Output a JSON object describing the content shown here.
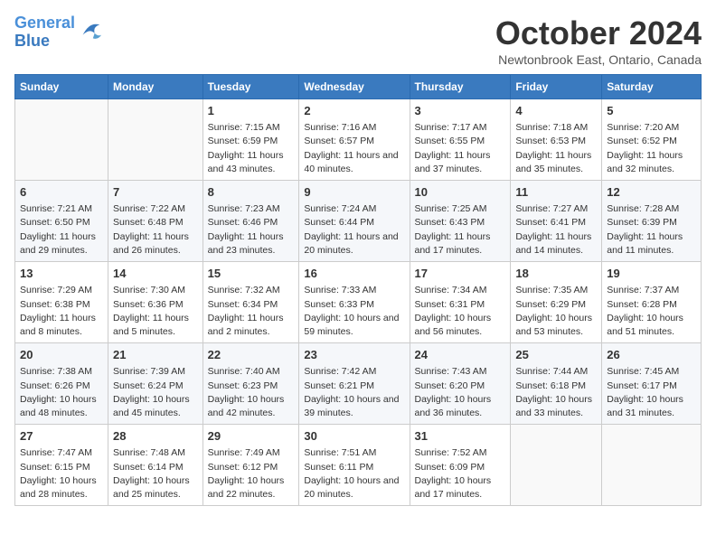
{
  "header": {
    "logo_line1": "General",
    "logo_line2": "Blue",
    "month_title": "October 2024",
    "location": "Newtonbrook East, Ontario, Canada"
  },
  "weekdays": [
    "Sunday",
    "Monday",
    "Tuesday",
    "Wednesday",
    "Thursday",
    "Friday",
    "Saturday"
  ],
  "weeks": [
    [
      {
        "num": "",
        "info": ""
      },
      {
        "num": "",
        "info": ""
      },
      {
        "num": "1",
        "info": "Sunrise: 7:15 AM\nSunset: 6:59 PM\nDaylight: 11 hours and 43 minutes."
      },
      {
        "num": "2",
        "info": "Sunrise: 7:16 AM\nSunset: 6:57 PM\nDaylight: 11 hours and 40 minutes."
      },
      {
        "num": "3",
        "info": "Sunrise: 7:17 AM\nSunset: 6:55 PM\nDaylight: 11 hours and 37 minutes."
      },
      {
        "num": "4",
        "info": "Sunrise: 7:18 AM\nSunset: 6:53 PM\nDaylight: 11 hours and 35 minutes."
      },
      {
        "num": "5",
        "info": "Sunrise: 7:20 AM\nSunset: 6:52 PM\nDaylight: 11 hours and 32 minutes."
      }
    ],
    [
      {
        "num": "6",
        "info": "Sunrise: 7:21 AM\nSunset: 6:50 PM\nDaylight: 11 hours and 29 minutes."
      },
      {
        "num": "7",
        "info": "Sunrise: 7:22 AM\nSunset: 6:48 PM\nDaylight: 11 hours and 26 minutes."
      },
      {
        "num": "8",
        "info": "Sunrise: 7:23 AM\nSunset: 6:46 PM\nDaylight: 11 hours and 23 minutes."
      },
      {
        "num": "9",
        "info": "Sunrise: 7:24 AM\nSunset: 6:44 PM\nDaylight: 11 hours and 20 minutes."
      },
      {
        "num": "10",
        "info": "Sunrise: 7:25 AM\nSunset: 6:43 PM\nDaylight: 11 hours and 17 minutes."
      },
      {
        "num": "11",
        "info": "Sunrise: 7:27 AM\nSunset: 6:41 PM\nDaylight: 11 hours and 14 minutes."
      },
      {
        "num": "12",
        "info": "Sunrise: 7:28 AM\nSunset: 6:39 PM\nDaylight: 11 hours and 11 minutes."
      }
    ],
    [
      {
        "num": "13",
        "info": "Sunrise: 7:29 AM\nSunset: 6:38 PM\nDaylight: 11 hours and 8 minutes."
      },
      {
        "num": "14",
        "info": "Sunrise: 7:30 AM\nSunset: 6:36 PM\nDaylight: 11 hours and 5 minutes."
      },
      {
        "num": "15",
        "info": "Sunrise: 7:32 AM\nSunset: 6:34 PM\nDaylight: 11 hours and 2 minutes."
      },
      {
        "num": "16",
        "info": "Sunrise: 7:33 AM\nSunset: 6:33 PM\nDaylight: 10 hours and 59 minutes."
      },
      {
        "num": "17",
        "info": "Sunrise: 7:34 AM\nSunset: 6:31 PM\nDaylight: 10 hours and 56 minutes."
      },
      {
        "num": "18",
        "info": "Sunrise: 7:35 AM\nSunset: 6:29 PM\nDaylight: 10 hours and 53 minutes."
      },
      {
        "num": "19",
        "info": "Sunrise: 7:37 AM\nSunset: 6:28 PM\nDaylight: 10 hours and 51 minutes."
      }
    ],
    [
      {
        "num": "20",
        "info": "Sunrise: 7:38 AM\nSunset: 6:26 PM\nDaylight: 10 hours and 48 minutes."
      },
      {
        "num": "21",
        "info": "Sunrise: 7:39 AM\nSunset: 6:24 PM\nDaylight: 10 hours and 45 minutes."
      },
      {
        "num": "22",
        "info": "Sunrise: 7:40 AM\nSunset: 6:23 PM\nDaylight: 10 hours and 42 minutes."
      },
      {
        "num": "23",
        "info": "Sunrise: 7:42 AM\nSunset: 6:21 PM\nDaylight: 10 hours and 39 minutes."
      },
      {
        "num": "24",
        "info": "Sunrise: 7:43 AM\nSunset: 6:20 PM\nDaylight: 10 hours and 36 minutes."
      },
      {
        "num": "25",
        "info": "Sunrise: 7:44 AM\nSunset: 6:18 PM\nDaylight: 10 hours and 33 minutes."
      },
      {
        "num": "26",
        "info": "Sunrise: 7:45 AM\nSunset: 6:17 PM\nDaylight: 10 hours and 31 minutes."
      }
    ],
    [
      {
        "num": "27",
        "info": "Sunrise: 7:47 AM\nSunset: 6:15 PM\nDaylight: 10 hours and 28 minutes."
      },
      {
        "num": "28",
        "info": "Sunrise: 7:48 AM\nSunset: 6:14 PM\nDaylight: 10 hours and 25 minutes."
      },
      {
        "num": "29",
        "info": "Sunrise: 7:49 AM\nSunset: 6:12 PM\nDaylight: 10 hours and 22 minutes."
      },
      {
        "num": "30",
        "info": "Sunrise: 7:51 AM\nSunset: 6:11 PM\nDaylight: 10 hours and 20 minutes."
      },
      {
        "num": "31",
        "info": "Sunrise: 7:52 AM\nSunset: 6:09 PM\nDaylight: 10 hours and 17 minutes."
      },
      {
        "num": "",
        "info": ""
      },
      {
        "num": "",
        "info": ""
      }
    ]
  ]
}
